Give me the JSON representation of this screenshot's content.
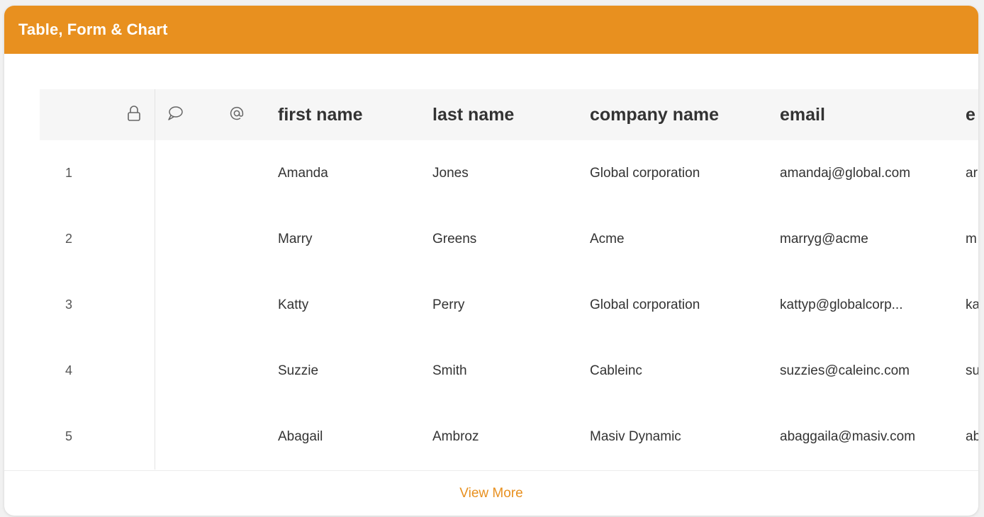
{
  "card": {
    "title": "Table, Form & Chart"
  },
  "colors": {
    "accent": "#e8901f",
    "header_bg": "#f6f6f6"
  },
  "table": {
    "icon_columns": [
      "lock-icon",
      "comment-icon",
      "mention-icon"
    ],
    "headers": [
      "first name",
      "last name",
      "company name",
      "email",
      "e"
    ],
    "rows": [
      {
        "index": "1",
        "first_name": "Amanda",
        "last_name": "Jones",
        "company": "Global corporation",
        "email": "amandaj@global.com",
        "extra": "ar"
      },
      {
        "index": "2",
        "first_name": "Marry",
        "last_name": "Greens",
        "company": "Acme",
        "email": "marryg@acme",
        "extra": "m"
      },
      {
        "index": "3",
        "first_name": "Katty",
        "last_name": "Perry",
        "company": "Global corporation",
        "email": "kattyp@globalcorp...",
        "extra": "ka"
      },
      {
        "index": "4",
        "first_name": "Suzzie",
        "last_name": "Smith",
        "company": "Cableinc",
        "email": "suzzies@caleinc.com",
        "extra": "su"
      },
      {
        "index": "5",
        "first_name": "Abagail",
        "last_name": "Ambroz",
        "company": "Masiv Dynamic",
        "email": "abaggaila@masiv.com",
        "extra": "ab"
      }
    ]
  },
  "footer": {
    "view_more_label": "View More"
  }
}
